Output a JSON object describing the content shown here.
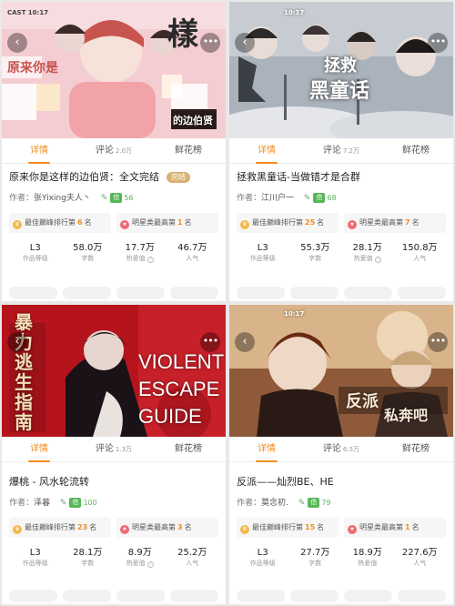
{
  "cards": [
    {
      "cover": {
        "bg": "#f2c6cc",
        "text_main": "原来你是",
        "text_sub": "的边伯贤",
        "text_date": "CAST 10:17",
        "accent": "#d94a66"
      },
      "tabs": [
        {
          "label": "详情",
          "count": ""
        },
        {
          "label": "评论",
          "count": "2.0万"
        },
        {
          "label": "鲜花榜",
          "count": ""
        }
      ],
      "title": "原来你是这样的边伯贤：全文完结",
      "complete_badge": "完结",
      "author_label": "作者：",
      "author": "张Yixing夫人丶",
      "author_badge": "信",
      "author_score": "56",
      "rank1": {
        "text": "最佳巅峰排行第",
        "value": "6",
        "unit": "名"
      },
      "rank2": {
        "text": "明星类最高第",
        "value": "1",
        "unit": "名"
      },
      "stats": [
        {
          "value": "L3",
          "label": "作品等级"
        },
        {
          "value": "58.0万",
          "label": "字数"
        },
        {
          "value": "17.7万",
          "label": "热爱值"
        },
        {
          "value": "46.7万",
          "label": "人气"
        }
      ]
    },
    {
      "cover": {
        "bg": "#9aa3ad",
        "text_main": "拯救",
        "text_sub": "黑童话",
        "text_date": "10:17",
        "accent": "#4a4f58"
      },
      "tabs": [
        {
          "label": "详情",
          "count": ""
        },
        {
          "label": "评论",
          "count": "7.2万"
        },
        {
          "label": "鲜花榜",
          "count": ""
        }
      ],
      "title": "拯救黑童话-当做错才是合群",
      "complete_badge": "",
      "author_label": "作者：",
      "author": "江川户一",
      "author_badge": "信",
      "author_score": "68",
      "rank1": {
        "text": "最佳巅峰排行第",
        "value": "25",
        "unit": "名"
      },
      "rank2": {
        "text": "明星类最高第",
        "value": "7",
        "unit": "名"
      },
      "stats": [
        {
          "value": "L3",
          "label": "作品等级"
        },
        {
          "value": "55.3万",
          "label": "字数"
        },
        {
          "value": "28.1万",
          "label": "热爱值"
        },
        {
          "value": "150.8万",
          "label": "人气"
        }
      ]
    },
    {
      "cover": {
        "bg": "#b5141c",
        "text_main": "VIOLENT",
        "text_mid": "ESCAPE",
        "text_sub": "GUIDE",
        "text_side": "暴力逃生指南",
        "accent": "#2a0508"
      },
      "tabs": [
        {
          "label": "详情",
          "count": ""
        },
        {
          "label": "评论",
          "count": "1.3万"
        },
        {
          "label": "鲜花榜",
          "count": ""
        }
      ],
      "title": "爆桃 - 风水轮流转",
      "complete_badge": "",
      "author_label": "作者：",
      "author": "泽暮",
      "author_badge": "信",
      "author_score": "100",
      "rank1": {
        "text": "最佳巅峰排行第",
        "value": "23",
        "unit": "名"
      },
      "rank2": {
        "text": "明星类最高第",
        "value": "3",
        "unit": "名"
      },
      "stats": [
        {
          "value": "L3",
          "label": "作品等级"
        },
        {
          "value": "28.1万",
          "label": "字数"
        },
        {
          "value": "8.9万",
          "label": "热爱值"
        },
        {
          "value": "25.2万",
          "label": "人气"
        }
      ]
    },
    {
      "cover": {
        "bg": "#c08a5a",
        "text_main": "反派",
        "text_sub": "私奔吧",
        "text_date": "10:17",
        "accent": "#5a2a14"
      },
      "tabs": [
        {
          "label": "详情",
          "count": ""
        },
        {
          "label": "评论",
          "count": "6.5万"
        },
        {
          "label": "鲜花榜",
          "count": ""
        }
      ],
      "title": "反派——灿烈BE、HE",
      "complete_badge": "",
      "author_label": "作者：",
      "author": "莫念初.",
      "author_badge": "信",
      "author_score": "79",
      "rank1": {
        "text": "最佳巅峰排行第",
        "value": "15",
        "unit": "名"
      },
      "rank2": {
        "text": "明星类最高第",
        "value": "1",
        "unit": "名"
      },
      "stats": [
        {
          "value": "L3",
          "label": "作品等级"
        },
        {
          "value": "27.7万",
          "label": "字数"
        },
        {
          "value": "18.9万",
          "label": "热爱值"
        },
        {
          "value": "227.6万",
          "label": "人气"
        }
      ]
    }
  ],
  "icons": {
    "back": "chevron-left-icon",
    "more": "more-dots-icon",
    "rank1": "crown-icon",
    "rank2": "star-icon",
    "help": "question-icon",
    "author_deco": "pen-icon"
  },
  "colors": {
    "accent": "#f08c1c",
    "badge_green": "#58b658",
    "complete_gold": "#d8b271"
  }
}
